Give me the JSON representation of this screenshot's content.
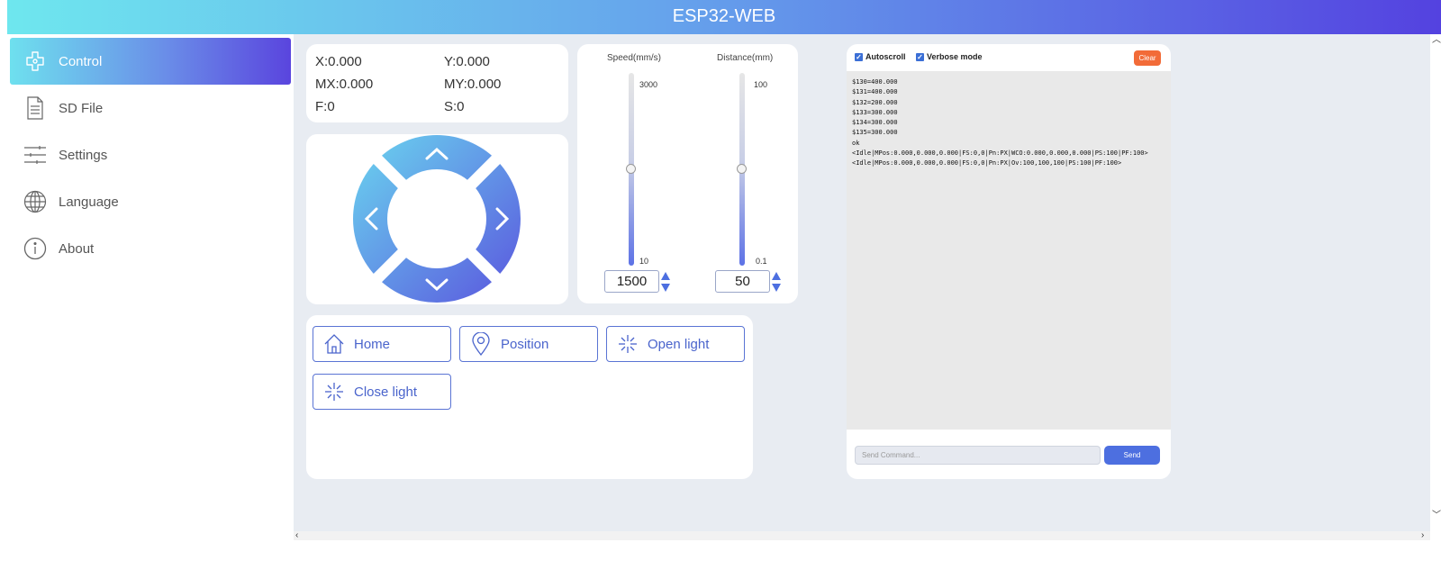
{
  "app": {
    "title": "ESP32-WEB"
  },
  "sidebar": {
    "items": [
      {
        "label": "Control",
        "icon": "gamepad-icon",
        "active": true
      },
      {
        "label": "SD File",
        "icon": "file-icon"
      },
      {
        "label": "Settings",
        "icon": "sliders-icon"
      },
      {
        "label": "Language",
        "icon": "globe-icon"
      },
      {
        "label": "About",
        "icon": "info-icon"
      }
    ]
  },
  "coords": {
    "x": "X:0.000",
    "y": "Y:0.000",
    "mx": "MX:0.000",
    "my": "MY:0.000",
    "f": "F:0",
    "s": "S:0"
  },
  "speed": {
    "label": "Speed(mm/s)",
    "max": "3000",
    "min": "10",
    "value": "1500",
    "level": 0.5
  },
  "distance": {
    "label": "Distance(mm)",
    "max": "100",
    "min": "0.1",
    "value": "50",
    "level": 0.5
  },
  "actions": {
    "home": "Home",
    "position": "Position",
    "open_light": "Open light",
    "close_light": "Close light"
  },
  "console": {
    "autoscroll": "Autoscroll",
    "verbose": "Verbose mode",
    "clear": "Clear",
    "lines": [
      "$130=400.000",
      "$131=400.000",
      "$132=200.000",
      "$133=300.000",
      "$134=300.000",
      "$135=300.000",
      "ok",
      "<Idle|MPos:0.000,0.000,0.000|FS:0,0|Pn:PX|WCO:0.000,0.000,0.000|PS:100|PF:100>",
      "<Idle|MPos:0.000,0.000,0.000|FS:0,0|Pn:PX|Ov:100,100,100|PS:100|PF:100>"
    ],
    "placeholder": "Send Command...",
    "send": "Send"
  },
  "colors": {
    "accent": "#4d6fe0",
    "clear": "#f26b38",
    "bg": "#e8ecf2"
  }
}
